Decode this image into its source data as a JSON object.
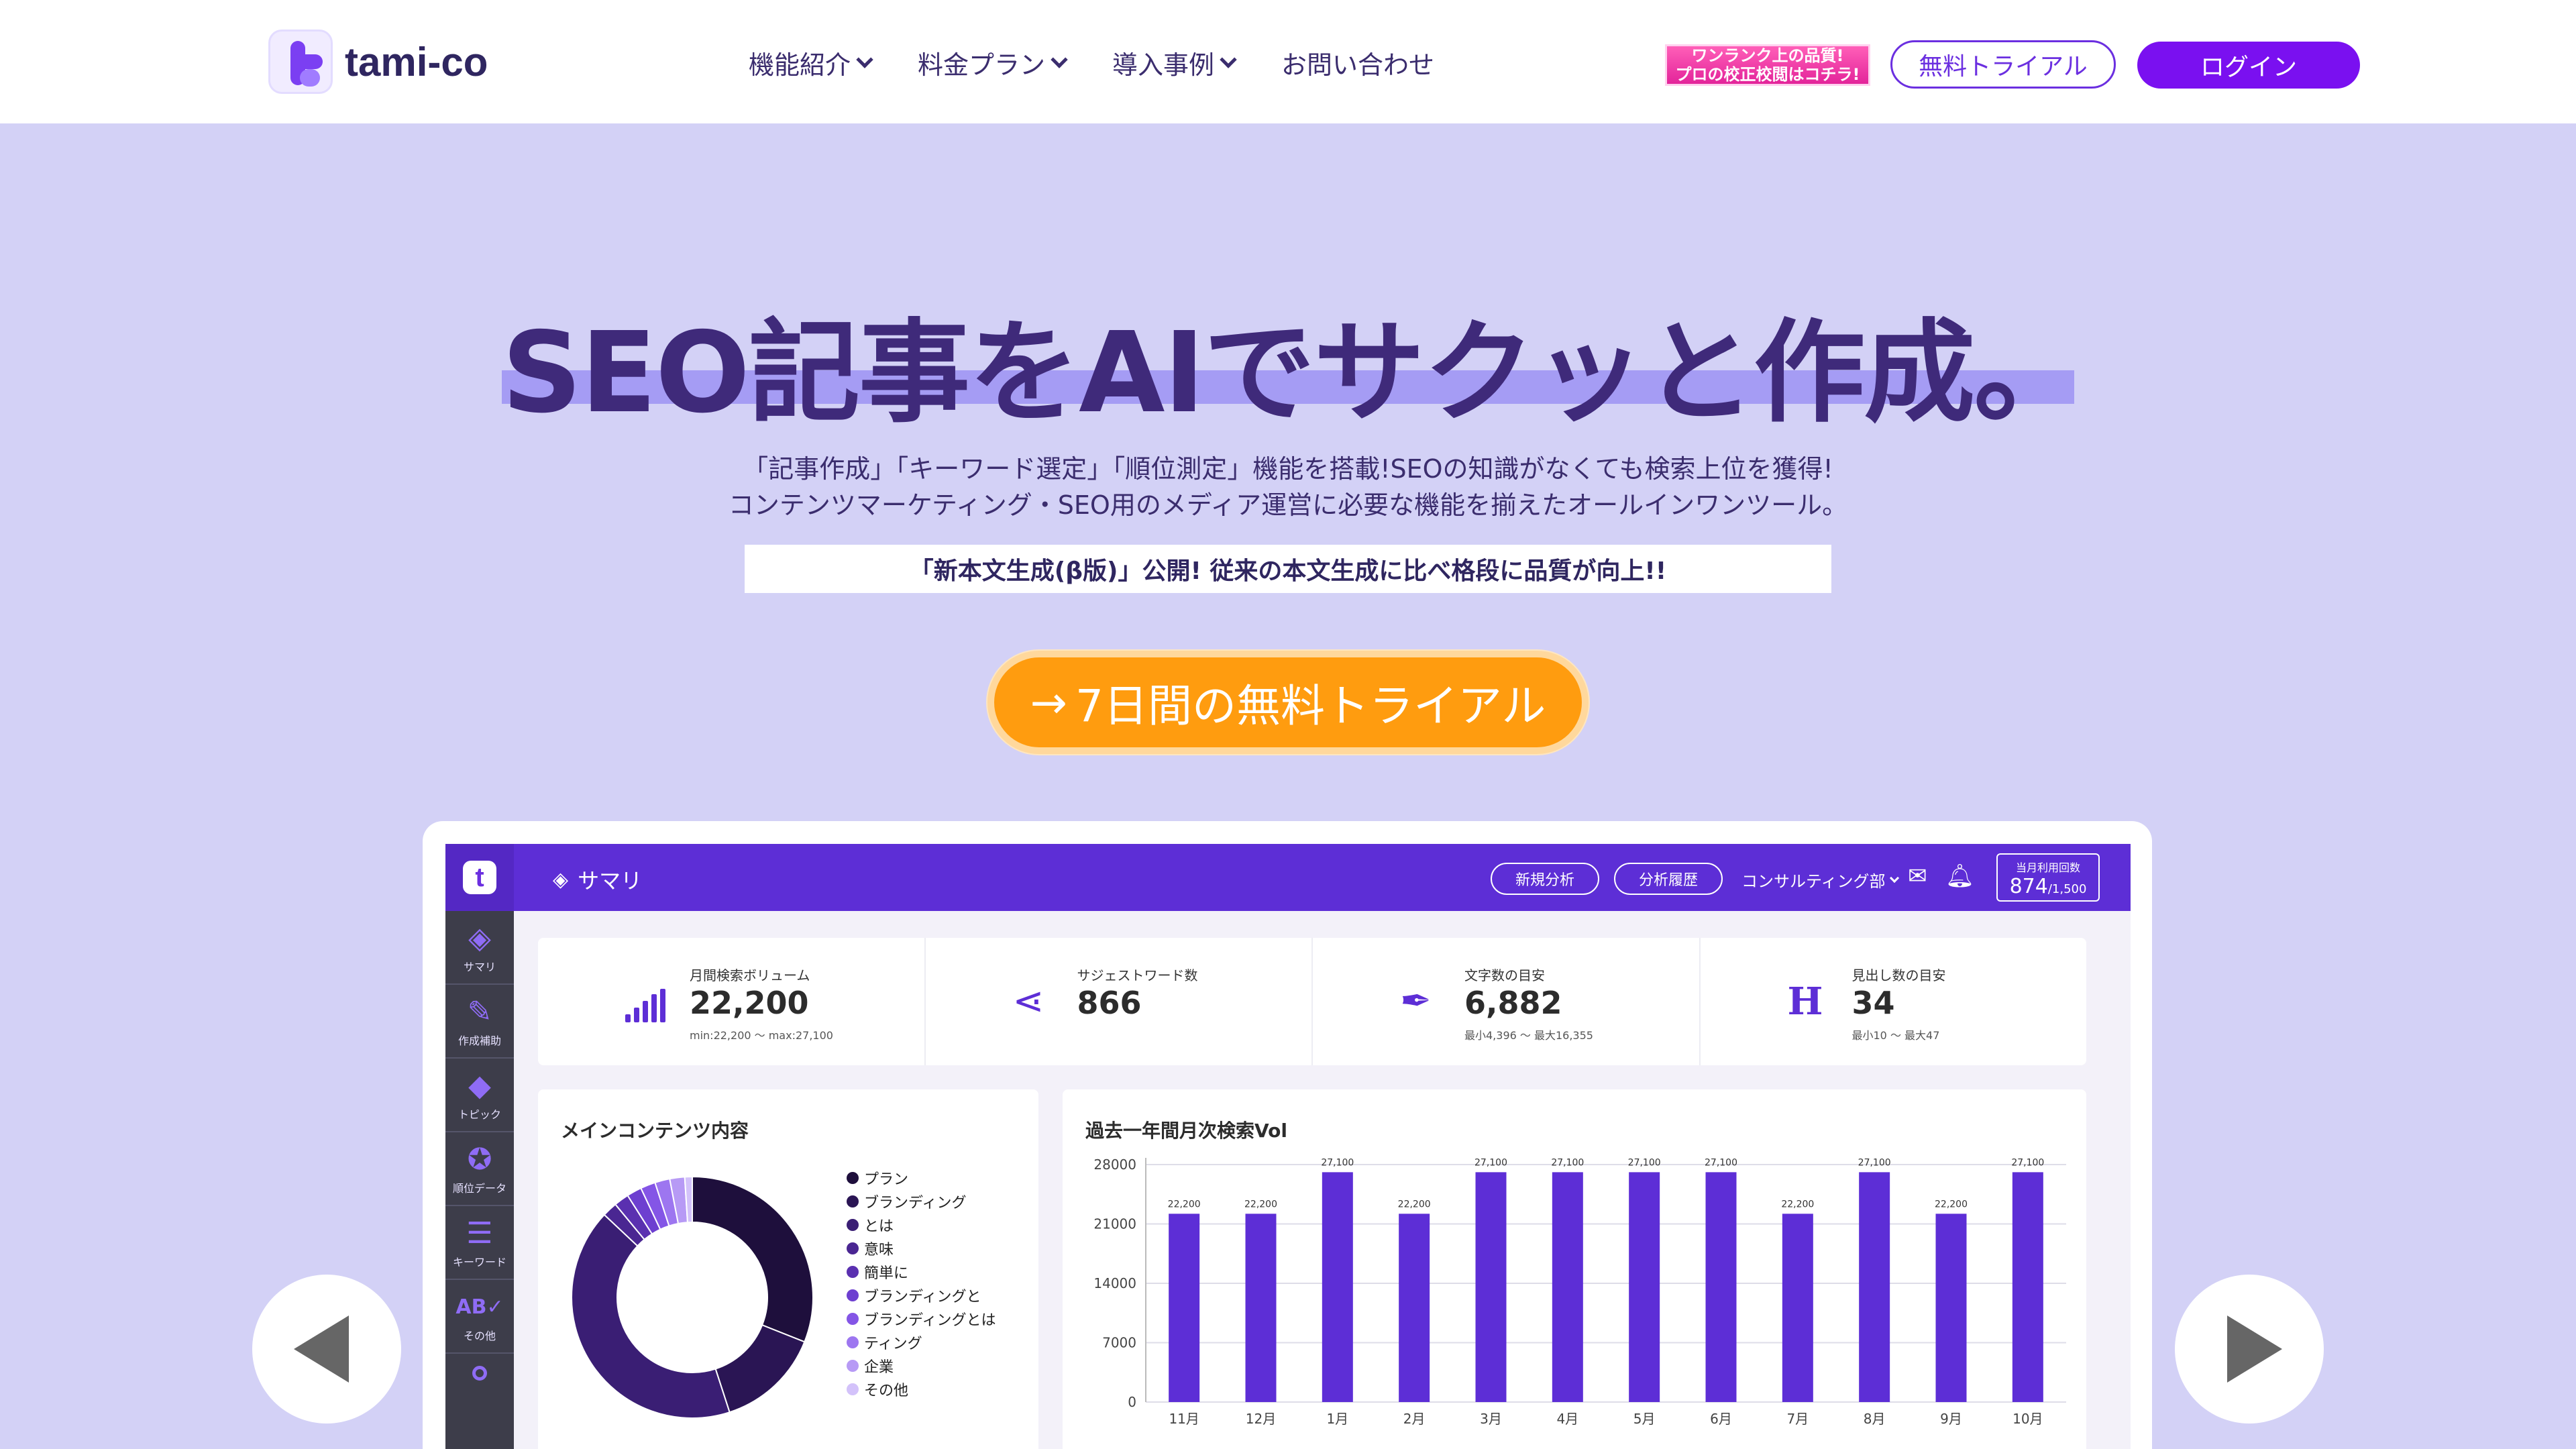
{
  "header": {
    "logo_text": "tami-co",
    "nav": [
      {
        "label": "機能紹介",
        "has_dropdown": true
      },
      {
        "label": "料金プラン",
        "has_dropdown": true
      },
      {
        "label": "導入事例",
        "has_dropdown": true
      },
      {
        "label": "お問い合わせ",
        "has_dropdown": false
      }
    ],
    "promo_line1": "ワンランク上の品質!",
    "promo_line2": "プロの校正校閲はコチラ!",
    "trial_button": "無料トライアル",
    "login_button": "ログイン"
  },
  "hero": {
    "title": "SEO記事をAIでサクッと作成。",
    "subtitle_line1": "「記事作成」「キーワード選定」「順位測定」機能を搭載!SEOの知識がなくても検索上位を獲得!",
    "subtitle_line2": "コンテンツマーケティング・SEO用のメディア運営に必要な機能を揃えたオールインワンツール。",
    "notice": "「新本文生成(β版)」公開! 従来の本文生成に比べ格段に品質が向上!!",
    "cta": "7日間の無料トライアル",
    "cta_icon": "arrow-right-icon"
  },
  "colors": {
    "accent": "#7a10f0",
    "hero_bg": "#d3d1f6",
    "cta": "#ff9c0f",
    "topbar": "#5d2ed6",
    "bar": "#5d2ed6"
  },
  "dashboard": {
    "page_title": "サマリ",
    "new_analysis": "新規分析",
    "history": "分析履歴",
    "department": "コンサルティング部",
    "usage_label": "当月利用回数",
    "usage_value": "874",
    "usage_limit": "/1,500",
    "sidebar": [
      {
        "icon": "layers-icon",
        "label": "サマリ"
      },
      {
        "icon": "pencil-ruler-icon",
        "label": "作成補助"
      },
      {
        "icon": "gem-icon",
        "label": "トピック"
      },
      {
        "icon": "medal-icon",
        "label": "順位データ"
      },
      {
        "icon": "list-icon",
        "label": "キーワード"
      },
      {
        "icon": "ab-check-icon",
        "label": "その他"
      }
    ],
    "stats": [
      {
        "icon": "bar-signal-icon",
        "label": "月間検索ボリューム",
        "value": "22,200",
        "sub": "min:22,200 〜 max:27,100"
      },
      {
        "icon": "share-icon",
        "label": "サジェストワード数",
        "value": "866",
        "sub": ""
      },
      {
        "icon": "pen-nib-icon",
        "label": "文字数の目安",
        "value": "6,882",
        "sub": "最小4,396 〜 最大16,355"
      },
      {
        "icon": "heading-icon",
        "label": "見出し数の目安",
        "value": "34",
        "sub": "最小10 〜 最大47"
      }
    ],
    "donut_panel_title": "メインコンテンツ内容",
    "bar_panel_title": "過去一年間月次検索Vol"
  },
  "chart_data": [
    {
      "type": "pie",
      "title": "メインコンテンツ内容",
      "categories": [
        "プラン",
        "ブランディング",
        "とは",
        "意味",
        "簡単に",
        "ブランディングと",
        "ブランディングとは",
        "ティング",
        "企業",
        "その他"
      ],
      "values": [
        31,
        14,
        42,
        2,
        2,
        2,
        2,
        2,
        2,
        1
      ],
      "colors": [
        "#1e0f3c",
        "#2a1554",
        "#3a1e74",
        "#4a2692",
        "#5a30b0",
        "#6d3fd0",
        "#8455e6",
        "#9d76f0",
        "#b79af5",
        "#d3c2fa"
      ],
      "legend_position": "right"
    },
    {
      "type": "bar",
      "title": "過去一年間月次検索Vol",
      "categories": [
        "11月",
        "12月",
        "1月",
        "2月",
        "3月",
        "4月",
        "5月",
        "6月",
        "7月",
        "8月",
        "9月",
        "10月"
      ],
      "values": [
        22200,
        22200,
        27100,
        22200,
        27100,
        27100,
        27100,
        27100,
        22200,
        27100,
        22200,
        27100
      ],
      "data_labels": [
        "22,200",
        "22,200",
        "27,100",
        "22,200",
        "27,100",
        "27,100",
        "27,100",
        "27,100",
        "22,200",
        "27,100",
        "22,200",
        "27,100"
      ],
      "y_ticks": [
        0,
        7000,
        14000,
        21000,
        28000
      ],
      "ylim": [
        0,
        28000
      ],
      "grid": true
    }
  ]
}
